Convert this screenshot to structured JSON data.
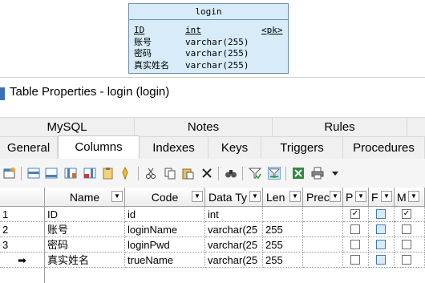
{
  "entity": {
    "title": "login",
    "rows": [
      {
        "name": "ID",
        "type": "int",
        "key": "<pk>"
      },
      {
        "name": "账号",
        "type": "varchar(255)",
        "key": ""
      },
      {
        "name": "密码",
        "type": "varchar(255)",
        "key": ""
      },
      {
        "name": "真实姓名",
        "type": "varchar(255)",
        "key": ""
      }
    ]
  },
  "window": {
    "title": "Table Properties - login (login)"
  },
  "tabs_row1": [
    "MySQL",
    "Notes",
    "Rules"
  ],
  "tabs_row2": [
    "General",
    "Columns",
    "Indexes",
    "Keys",
    "Triggers",
    "Procedures"
  ],
  "active_tab": "Columns",
  "toolbar": {
    "icons": [
      "properties-icon",
      "insert-row-icon",
      "add-row-icon",
      "add-columns-icon",
      "remove-columns-icon",
      "paste-icon",
      "find-icon",
      "cut-icon",
      "copy-icon",
      "paste-icon",
      "delete-icon",
      "binoculars-icon",
      "filter-icon",
      "filter-active-icon",
      "excel-icon",
      "print-icon",
      "dropdown-icon"
    ]
  },
  "grid": {
    "headers": [
      "Name",
      "Code",
      "Data Ty",
      "Len",
      "Prec",
      "P",
      "F",
      "M"
    ],
    "rows": [
      {
        "num": "1",
        "name": "ID",
        "code": "id",
        "type": "int",
        "len": "",
        "prec": "",
        "p": true,
        "f": false,
        "m": true
      },
      {
        "num": "2",
        "name": "账号",
        "code": "loginName",
        "type": "varchar(25",
        "len": "255",
        "prec": "",
        "p": false,
        "f": false,
        "m": false
      },
      {
        "num": "3",
        "name": "密码",
        "code": "loginPwd",
        "type": "varchar(25",
        "len": "255",
        "prec": "",
        "p": false,
        "f": false,
        "m": false
      },
      {
        "num": "➡",
        "name": "真实姓名",
        "code": "trueName",
        "type": "varchar(25",
        "len": "255",
        "prec": "",
        "p": false,
        "f": false,
        "m": false
      }
    ]
  }
}
